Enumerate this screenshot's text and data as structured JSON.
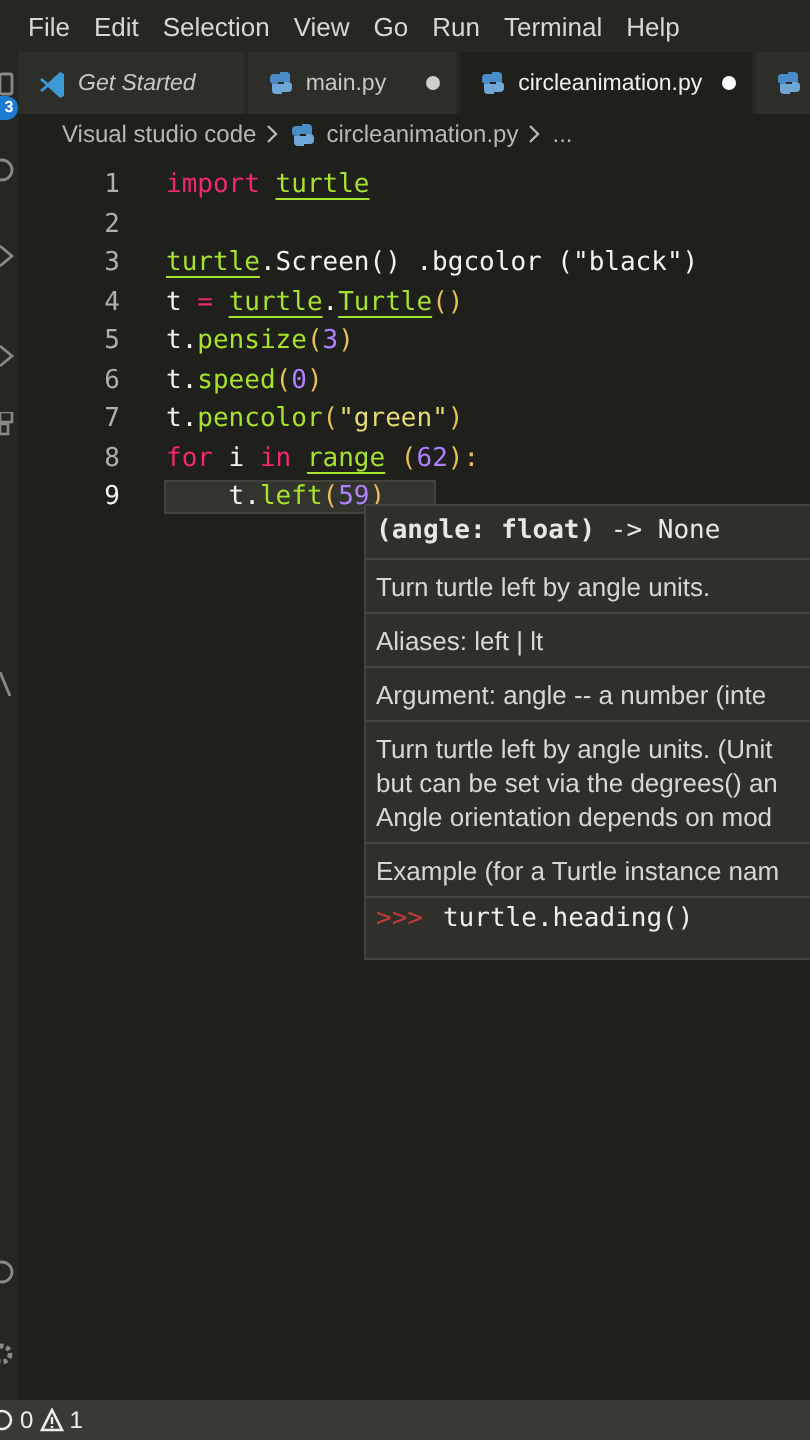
{
  "menu_bar": [
    "File",
    "Edit",
    "Selection",
    "View",
    "Go",
    "Run",
    "Terminal",
    "Help"
  ],
  "activity_bar": {
    "badge": "3"
  },
  "tabs": [
    {
      "kind": "vscode",
      "label": "Get Started",
      "preview": true,
      "modified": false,
      "selected": false
    },
    {
      "kind": "python",
      "label": "main.py",
      "preview": false,
      "modified": true,
      "selected": false
    },
    {
      "kind": "python",
      "label": "circleanimation.py",
      "preview": false,
      "modified": true,
      "selected": true
    },
    {
      "kind": "python",
      "selected": false
    }
  ],
  "breadcrumb": [
    "Visual studio code",
    "circleanimation.py",
    "..."
  ],
  "editor": {
    "lines": [
      {
        "number": "1",
        "current": false,
        "tokens": [
          {
            "text": "import",
            "kind": "kw"
          },
          {
            "text": " turtle",
            "kind": "mod",
            "underlined": true
          }
        ]
      },
      {
        "number": "2",
        "current": false
      },
      {
        "number": "3",
        "current": false,
        "tokens": [
          {
            "text": "turtle",
            "kind": "mod",
            "underlined": true
          },
          {
            "text": ".Screen() .bgcolor (\"black\")",
            "kind": "plain"
          }
        ]
      },
      {
        "number": "4",
        "current": false,
        "tokens": [
          {
            "text": "t",
            "kind": "plain"
          },
          {
            "text": " = ",
            "kind": "kw"
          },
          {
            "text": "turtle",
            "kind": "mod",
            "underlined": true
          },
          {
            "text": ".",
            "kind": "plain"
          },
          {
            "text": "Turtle",
            "kind": "fn",
            "underlined": true
          },
          {
            "text": "()",
            "kind": "paren"
          }
        ]
      },
      {
        "number": "5",
        "current": false,
        "tokens": [
          {
            "text": "t.",
            "kind": "plain"
          },
          {
            "text": "pensize",
            "kind": "fn"
          },
          {
            "text": "(",
            "kind": "paren"
          },
          {
            "text": "3",
            "kind": "num"
          },
          {
            "text": ")",
            "kind": "paren"
          }
        ]
      },
      {
        "number": "6",
        "current": false,
        "tokens": [
          {
            "text": "t.",
            "kind": "plain"
          },
          {
            "text": "speed",
            "kind": "fn"
          },
          {
            "text": "(",
            "kind": "paren"
          },
          {
            "text": "0",
            "kind": "num"
          },
          {
            "text": ")",
            "kind": "paren"
          }
        ]
      },
      {
        "number": "7",
        "current": false,
        "tokens": [
          {
            "text": "t.",
            "kind": "plain"
          },
          {
            "text": "pencolor",
            "kind": "fn"
          },
          {
            "text": "(",
            "kind": "paren"
          },
          {
            "text": "\"green\"",
            "kind": "str"
          },
          {
            "text": ")",
            "kind": "paren"
          }
        ]
      },
      {
        "number": "8",
        "current": false,
        "tokens": [
          {
            "text": "for",
            "kind": "kw"
          },
          {
            "text": " i ",
            "kind": "plain"
          },
          {
            "text": "in",
            "kind": "kw"
          },
          {
            "text": " range",
            "kind": "fn",
            "underlined": true
          },
          {
            "text": " (",
            "kind": "paren"
          },
          {
            "text": "62",
            "kind": "num"
          },
          {
            "text": "):",
            "kind": "paren"
          }
        ]
      },
      {
        "number": "9",
        "current": true,
        "tokens": [
          {
            "text": "    t.",
            "kind": "plain"
          },
          {
            "text": "left",
            "kind": "fn"
          },
          {
            "text": "(",
            "kind": "paren"
          },
          {
            "text": "59",
            "kind": "num"
          },
          {
            "text": ")",
            "kind": "paren"
          }
        ]
      }
    ]
  },
  "hover": {
    "signature": [
      {
        "text": "(angle: float)",
        "kind": "bold"
      },
      {
        "text": " -> None",
        "kind": "plain"
      }
    ],
    "paragraphs": [
      [
        "Turn turtle left by angle units."
      ],
      [
        "Aliases: left | lt"
      ],
      [
        "Argument: angle -- a number (inte"
      ],
      [
        "Turn turtle left by angle units. (Unit",
        "but can be set via the degrees() an",
        "Angle orientation depends on mod"
      ],
      [
        "Example (for a Turtle instance nam"
      ]
    ],
    "example": {
      "prompt": ">>>",
      "code": "turtle.heading()"
    }
  },
  "status_bar": {
    "errors": "0",
    "warnings": "1"
  }
}
